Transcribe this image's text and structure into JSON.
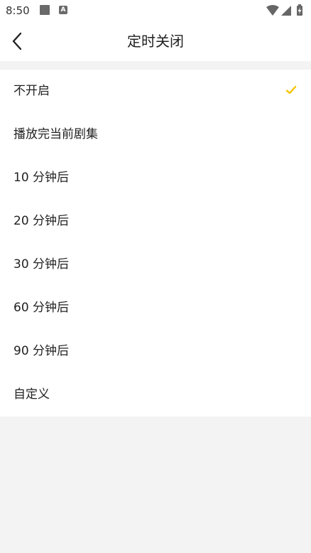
{
  "status_bar": {
    "time": "8:50",
    "icons": [
      "square-icon",
      "a-icon",
      "wifi-icon",
      "signal-icon",
      "battery-charging-icon"
    ]
  },
  "header": {
    "title": "定时关闭",
    "back_icon": "chevron-left-icon"
  },
  "options": [
    {
      "label": "不开启",
      "selected": true
    },
    {
      "label": "播放完当前剧集",
      "selected": false
    },
    {
      "label": "10 分钟后",
      "selected": false
    },
    {
      "label": "20 分钟后",
      "selected": false
    },
    {
      "label": "30 分钟后",
      "selected": false
    },
    {
      "label": "60 分钟后",
      "selected": false
    },
    {
      "label": "90 分钟后",
      "selected": false
    },
    {
      "label": "自定义",
      "selected": false
    }
  ],
  "colors": {
    "accent": "#f5c400",
    "background": "#f3f3f3",
    "surface": "#ffffff",
    "text": "#222222"
  }
}
